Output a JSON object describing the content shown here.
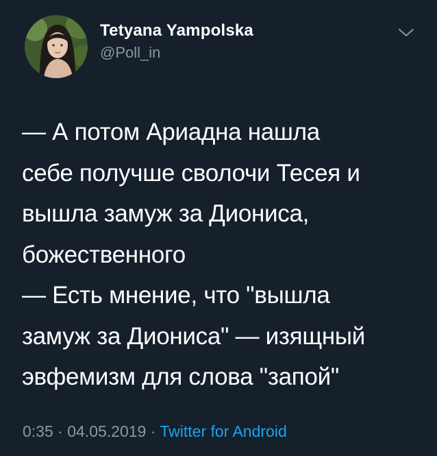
{
  "author": {
    "display_name": "Tetyana Yampolska",
    "handle": "@Poll_in",
    "avatar_icon": "user-avatar-photo"
  },
  "menu": {
    "icon": "chevron-down-icon"
  },
  "tweet": {
    "lines": [
      "— А потом Ариадна нашла",
      "себе получше сволочи Тесея и",
      "вышла замуж за Диониса,",
      "божественного",
      "— Есть мнение, что \"вышла",
      "замуж за Диониса\" — изящный",
      "эвфемизм для слова \"запой\""
    ]
  },
  "meta": {
    "time": "0:35",
    "separator": " · ",
    "date": "04.05.2019",
    "source": "Twitter for Android"
  },
  "colors": {
    "background": "#15202b",
    "primary_text": "#ffffff",
    "secondary_text": "#8899a6",
    "accent": "#1da1f2"
  }
}
